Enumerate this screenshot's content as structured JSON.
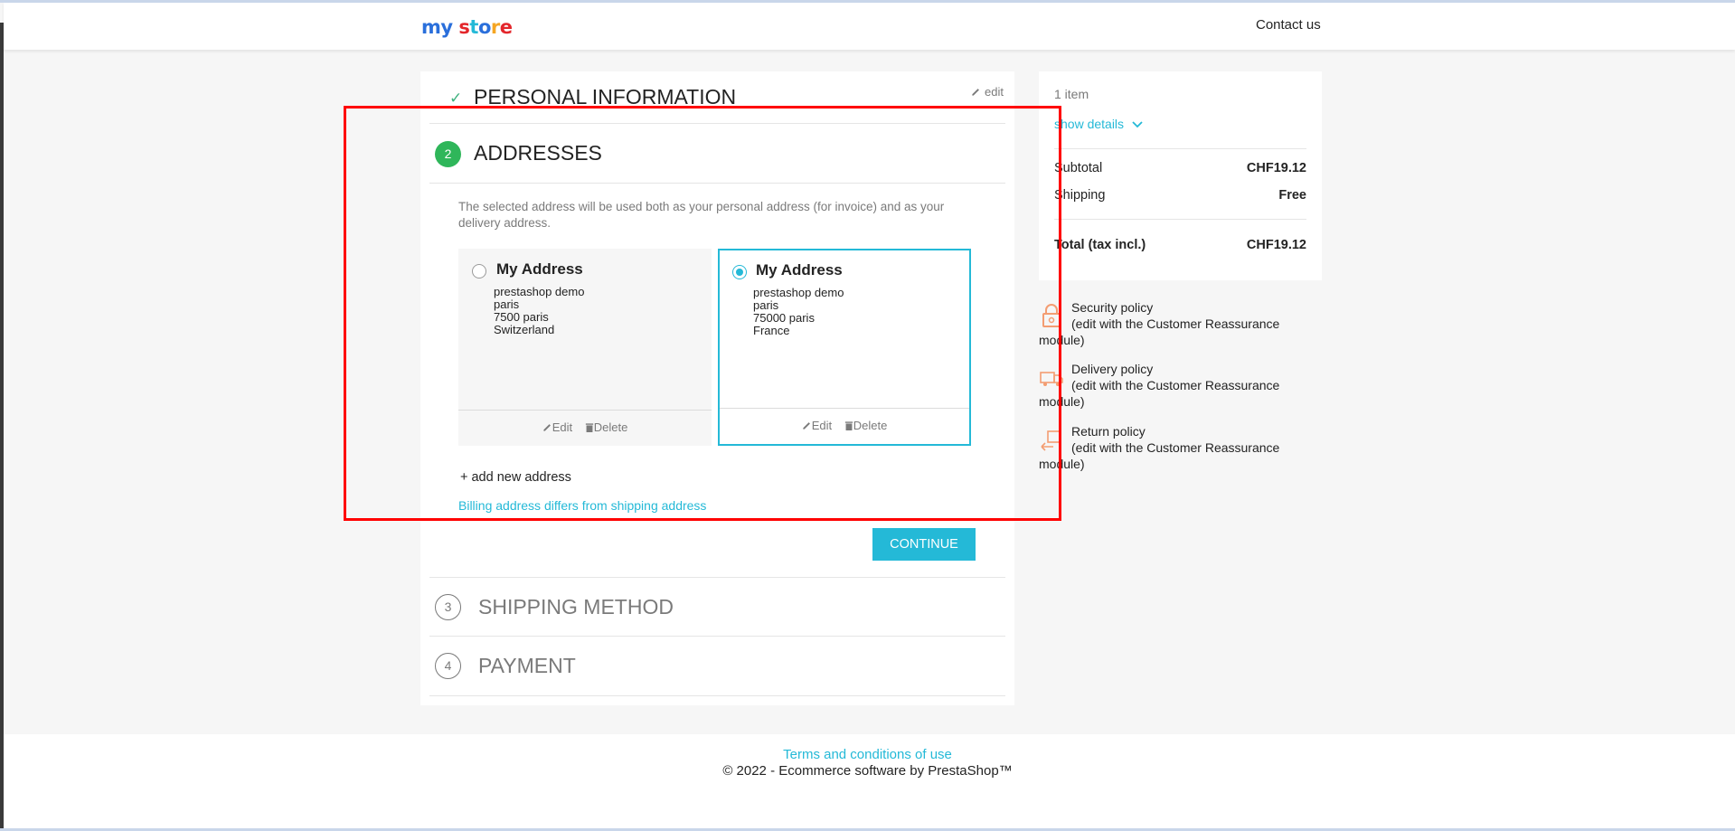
{
  "header": {
    "logo_parts": [
      "my",
      " ",
      "s",
      "t",
      "o",
      "r",
      "e"
    ],
    "contact_label": "Contact us"
  },
  "checkout": {
    "personal": {
      "title": "PERSONAL INFORMATION",
      "edit_label": "edit"
    },
    "addresses": {
      "number": "2",
      "title": "ADDRESSES",
      "info": "The selected address will be used both as your personal address (for invoice) and as your delivery address.",
      "cards": [
        {
          "alias": "My Address",
          "lines": [
            "prestashop demo",
            "paris",
            "7500 paris",
            "Switzerland"
          ],
          "selected": false,
          "edit_label": "Edit",
          "delete_label": "Delete"
        },
        {
          "alias": "My Address",
          "lines": [
            "prestashop demo",
            "paris",
            "75000 paris",
            "France"
          ],
          "selected": true,
          "edit_label": "Edit",
          "delete_label": "Delete"
        }
      ],
      "add_new_label": "+ add new address",
      "billing_link": "Billing address differs from shipping address",
      "continue_label": "CONTINUE"
    },
    "shipping": {
      "number": "3",
      "title": "SHIPPING METHOD"
    },
    "payment": {
      "number": "4",
      "title": "PAYMENT"
    }
  },
  "summary": {
    "items_count": "1 item",
    "show_details": "show details",
    "subtotal_label": "Subtotal",
    "subtotal_value": "CHF19.12",
    "shipping_label": "Shipping",
    "shipping_value": "Free",
    "total_label": "Total (tax incl.)",
    "total_value": "CHF19.12"
  },
  "reassurance": [
    {
      "title": "Security policy",
      "desc": "(edit with the Customer Reassurance module)",
      "icon": "lock-icon"
    },
    {
      "title": "Delivery policy",
      "desc": "(edit with the Customer Reassurance module)",
      "icon": "truck-icon"
    },
    {
      "title": "Return policy",
      "desc": "(edit with the Customer Reassurance module)",
      "icon": "return-box-icon"
    }
  ],
  "footer": {
    "terms": "Terms and conditions of use",
    "copyright": "© 2022 - Ecommerce software by PrestaShop™"
  },
  "colors": {
    "accent": "#24b9d7",
    "success": "#2fb65a",
    "annotation": "#ff0000"
  }
}
